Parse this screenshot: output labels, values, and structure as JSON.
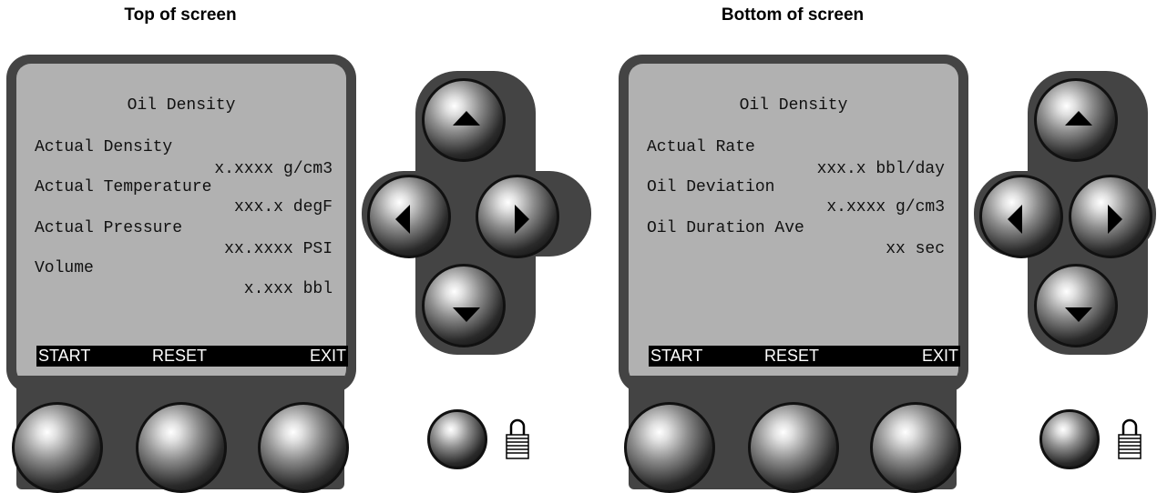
{
  "captions": {
    "left": "Top of screen",
    "right": "Bottom of screen"
  },
  "panels": [
    {
      "screen_title": "Oil Density",
      "lines": [
        {
          "label": "Actual Density",
          "value": "x.xxxx g/cm3"
        },
        {
          "label": "Actual Temperature",
          "value": "xxx.x degF"
        },
        {
          "label": "Actual Pressure",
          "value": "xx.xxxx PSI"
        },
        {
          "label": "Volume",
          "value": "x.xxx bbl"
        }
      ],
      "softkeys": {
        "left": "START",
        "middle": "RESET",
        "right": "EXIT"
      }
    },
    {
      "screen_title": "Oil Density",
      "lines": [
        {
          "label": "Actual Rate",
          "value": "xxx.x bbl/day"
        },
        {
          "label": "Oil Deviation",
          "value": "x.xxxx g/cm3"
        },
        {
          "label": "Oil Duration Ave",
          "value": "xx sec"
        }
      ],
      "softkeys": {
        "left": "START",
        "middle": "RESET",
        "right": "EXIT"
      }
    }
  ],
  "icons": {
    "nav_up": "up-arrow-icon",
    "nav_down": "down-arrow-icon",
    "nav_left": "left-arrow-icon",
    "nav_right": "right-arrow-icon",
    "lock": "padlock-icon"
  },
  "colors": {
    "bezel": "#444444",
    "screen": "#b1b1b1",
    "softkey_bar": "#000000",
    "softkey_text": "#ffffff"
  }
}
